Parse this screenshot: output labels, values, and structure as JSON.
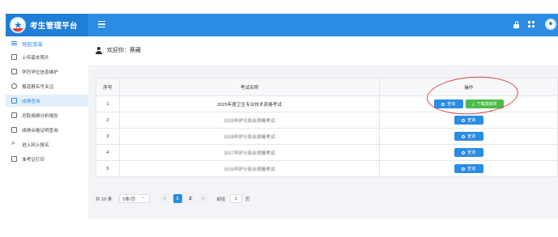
{
  "app": {
    "title": "考生管理平台"
  },
  "sidebar": {
    "header": "导航菜单",
    "items": [
      {
        "label": "上传基本照片",
        "icon": "image-icon"
      },
      {
        "label": "学历学位信息维护",
        "icon": "document-icon"
      },
      {
        "label": "报道报名号关注",
        "icon": "link-icon"
      },
      {
        "label": "成绩查询",
        "icon": "file-icon",
        "active": true
      },
      {
        "label": "总取成绩分析报告",
        "icon": "report-icon"
      },
      {
        "label": "成绩合格证明查询",
        "icon": "certificate-icon"
      },
      {
        "label": "进入网上报名",
        "icon": "arrow-right-icon"
      },
      {
        "label": "准考证打印",
        "icon": "print-icon"
      }
    ]
  },
  "welcome": {
    "prefix": "欢迎你：",
    "name": "蔡藏"
  },
  "table": {
    "headers": {
      "num": "序号",
      "name": "考试名称",
      "op": "操作"
    },
    "rows": [
      {
        "num": "1",
        "name": "2025年度卫生专业技术资格考试",
        "blurred": false,
        "download": true
      },
      {
        "num": "2",
        "name": "2019年护士执业资格考试",
        "blurred": true,
        "download": false
      },
      {
        "num": "3",
        "name": "2018年护士执业资格考试",
        "blurred": true,
        "download": false
      },
      {
        "num": "4",
        "name": "2017年护士执业资格考试",
        "blurred": true,
        "download": false
      },
      {
        "num": "5",
        "name": "2016年护士执业资格考试",
        "blurred": true,
        "download": false
      }
    ],
    "query_label": "查询",
    "download_label": "下载成绩单"
  },
  "pager": {
    "total": "共 10 条",
    "page_size": "5条/页",
    "prev": "<",
    "pages": [
      "1",
      "2"
    ],
    "next": ">",
    "goto_label": "前往",
    "goto_value": "1",
    "unit": "页"
  },
  "colors": {
    "brand": "#1f7fd6",
    "topbar": "#2b8ce4",
    "download": "#4cba4c",
    "annotation": "#d84a4a"
  }
}
